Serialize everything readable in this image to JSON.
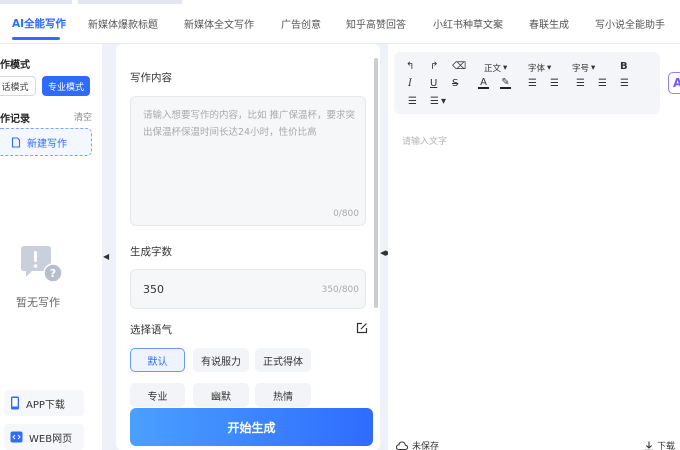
{
  "tabs": [
    {
      "label": "AI全能写作",
      "active": true
    },
    {
      "label": "新媒体爆款标题"
    },
    {
      "label": "新媒体全文写作"
    },
    {
      "label": "广告创意"
    },
    {
      "label": "知乎高赞回答"
    },
    {
      "label": "小红书种草文案"
    },
    {
      "label": "春联生成"
    },
    {
      "label": "写小说全能助手"
    }
  ],
  "sidebar": {
    "mode_title": "作模式",
    "mode_dialog": "话模式",
    "mode_pro": "专业模式",
    "record_title": "作记录",
    "clear": "清空",
    "new_write": "新建写作",
    "empty_text": "暂无写作",
    "app_download": "APP下载",
    "web_page": "WEB网页"
  },
  "form": {
    "content_label": "写作内容",
    "content_placeholder": "请输入想要写作的内容，比如 推广保温杯，要求突出保温杯保温时间长达24小时，性价比高",
    "content_counter": "0/800",
    "count_label": "生成字数",
    "count_value": "350",
    "count_counter": "350/800",
    "tone_label": "选择语气",
    "tones": [
      "默认",
      "有说服力",
      "正式得体",
      "专业",
      "幽默",
      "热情"
    ],
    "selected_tone": "默认",
    "start_button": "开始生成"
  },
  "editor": {
    "para_select": "正文",
    "font_select": "字体",
    "size_select": "字号",
    "placeholder": "请输入文字",
    "save_status": "未保存",
    "download": "下载",
    "ai_badge": "A"
  },
  "colors": {
    "accent": "#2f6bff",
    "gradient_start": "#4aa0ff",
    "selected_border": "#6d96ff",
    "ai_badge": "#7b55ff"
  }
}
